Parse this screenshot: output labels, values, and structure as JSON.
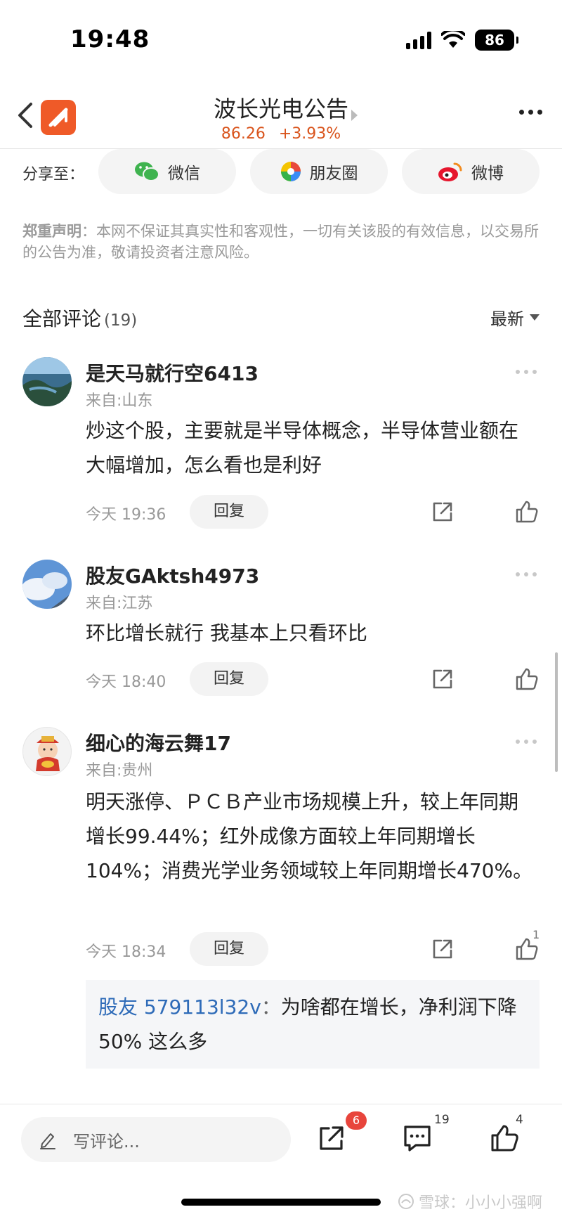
{
  "status_bar": {
    "time": "19:48",
    "battery": "86"
  },
  "header": {
    "title": "波长光电公告",
    "price": "86.26",
    "change": "+3.93%"
  },
  "share": {
    "label": "分享至：",
    "options": [
      {
        "label": "微信",
        "icon": "wechat-icon"
      },
      {
        "label": "朋友圈",
        "icon": "moments-icon"
      },
      {
        "label": "微博",
        "icon": "weibo-icon"
      }
    ]
  },
  "disclaimer": {
    "title": "郑重声明",
    "text": "：本网不保证其真实性和客观性，一切有关该股的有效信息，以交易所的公告为准，敬请投资者注意风险。"
  },
  "comments_header": {
    "title": "全部评论",
    "count": "(19)",
    "sort": "最新"
  },
  "comments": [
    {
      "name": "是天马就行空6413",
      "location": "来自:山东",
      "text": "炒这个股，主要就是半导体概念，半导体营业额在大幅增加，怎么看也是利好",
      "time": "今天 19:36",
      "reply": "回复",
      "likes": ""
    },
    {
      "name": "股友GAktsh4973",
      "location": "来自:江苏",
      "text": "环比增长就行 我基本上只看环比",
      "time": "今天 18:40",
      "reply": "回复",
      "likes": ""
    },
    {
      "name": "细心的海云舞17",
      "location": "来自:贵州",
      "text": "明天涨停、ＰＣＢ产业市场规模上升，较上年同期增长99.44%；红外成像方面较上年同期增长104%；消费光学业务领域较上年同期增长470%。",
      "time": "今天 18:34",
      "reply": "回复",
      "likes": "1",
      "sub_reply": {
        "user": "股友 579113l32v",
        "colon": "：",
        "text": "为啥都在增长，净利润下降 50% 这么多"
      }
    }
  ],
  "bottom_bar": {
    "placeholder": "写评论...",
    "share_badge": "6",
    "comment_count": "19",
    "like_count": "4",
    "watermark": "雪球：小小小强啊"
  }
}
